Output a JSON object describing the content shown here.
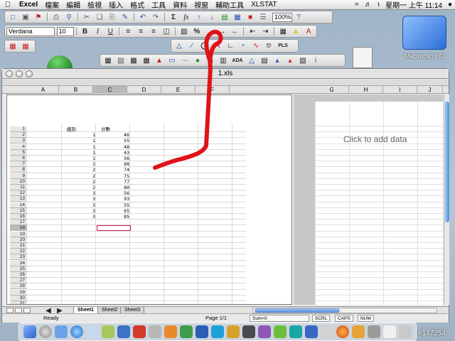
{
  "menubar": {
    "app": "Excel",
    "items": [
      "檔案",
      "編輯",
      "檢視",
      "插入",
      "格式",
      "工具",
      "資料",
      "視窗",
      "輔助工具",
      "XLSTAT"
    ],
    "clock": "星期一 上午 11:14"
  },
  "format_toolbar": {
    "font": "Verdana",
    "size": "10",
    "bold": "B",
    "italic": "I",
    "underline": "U",
    "percent": "%"
  },
  "standard_toolbar": {
    "sigma": "Σ",
    "fx": "fx",
    "zoom": "100%"
  },
  "xlstat_toolbar": {
    "pls": "PLS",
    "ada": "ADA"
  },
  "desktop": {
    "hd_label": "Macintosh HD"
  },
  "window": {
    "title": "1.xls",
    "columns": [
      "A",
      "B",
      "C",
      "D",
      "E",
      "F",
      "G",
      "H",
      "I",
      "J"
    ],
    "active_column": "C",
    "right_placeholder": "Click to add data",
    "header_b": "組別",
    "header_c": "分數",
    "rows": [
      {
        "n": "1",
        "b": "",
        "c": ""
      },
      {
        "n": "2",
        "b": "1",
        "c": "46"
      },
      {
        "n": "3",
        "b": "1",
        "c": "55"
      },
      {
        "n": "4",
        "b": "1",
        "c": "48"
      },
      {
        "n": "5",
        "b": "1",
        "c": "43"
      },
      {
        "n": "6",
        "b": "1",
        "c": "56"
      },
      {
        "n": "7",
        "b": "2",
        "c": "88"
      },
      {
        "n": "8",
        "b": "2",
        "c": "74"
      },
      {
        "n": "9",
        "b": "2",
        "c": "75"
      },
      {
        "n": "10",
        "b": "2",
        "c": "77"
      },
      {
        "n": "11",
        "b": "2",
        "c": "80"
      },
      {
        "n": "12",
        "b": "3",
        "c": "56"
      },
      {
        "n": "13",
        "b": "3",
        "c": "93"
      },
      {
        "n": "14",
        "b": "3",
        "c": "55"
      },
      {
        "n": "15",
        "b": "3",
        "c": "65"
      },
      {
        "n": "16",
        "b": "3",
        "c": "85"
      }
    ],
    "empty_rows": [
      "17",
      "18",
      "19",
      "20",
      "21",
      "22",
      "23",
      "24",
      "25",
      "26",
      "27",
      "28",
      "29",
      "30",
      "31"
    ],
    "active_row": "18",
    "sheets": [
      "Sheet1",
      "Sheet2",
      "Sheet3"
    ],
    "active_sheet": "Sheet1"
  },
  "statusbar": {
    "ready": "Ready",
    "page": "Page 1/1",
    "sum": "Sum=0",
    "scrl": "SCRL",
    "caps": "CAPS",
    "num": "NUM"
  },
  "watermark": "#147254",
  "colors": {
    "annotation": "#e0121a",
    "selection": "#d02050",
    "accent": "#4f8fdc"
  }
}
